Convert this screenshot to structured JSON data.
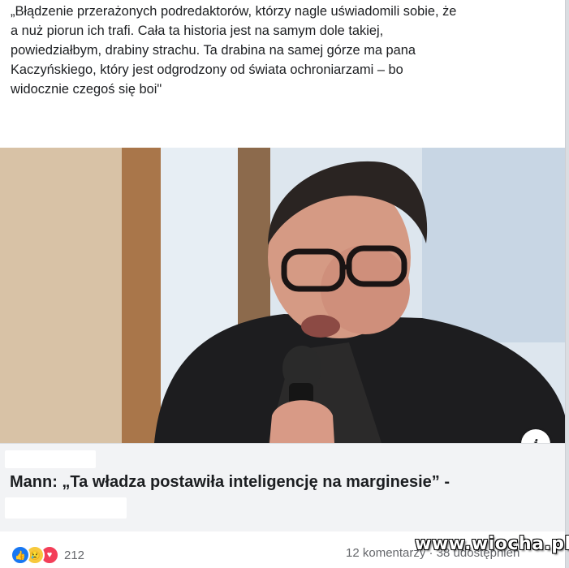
{
  "post": {
    "text": "„Błądzenie przerażonych podredaktorów, którzy nagle uświadomili sobie, że\na nuż piorun ich trafi. Cała ta historia jest na samym dole takiej,\npowiedziałbym, drabiny strachu. Ta drabina na samej górze ma pana\nKaczyńskiego, który jest odgrodzony od świata ochroniarzami – bo\nwidocznie czegoś się boi\""
  },
  "link": {
    "title": "Mann: „Ta władza postawiła inteligencję na marginesie” -",
    "info_icon": "i"
  },
  "reactions": {
    "icons": [
      "like-icon",
      "sad-icon",
      "love-icon"
    ],
    "like_glyph": "👍",
    "sad_glyph": "😢",
    "love_glyph": "♥",
    "count": "212"
  },
  "stats": {
    "text": "12 komentarzy · 38 udostępnień"
  },
  "watermark": {
    "text": "www.wiocha.pl"
  },
  "colors": {
    "like": "#1877f2",
    "sad": "#f7c93d",
    "love": "#f33e58",
    "text": "#1c1e21",
    "muted": "#65676b"
  }
}
